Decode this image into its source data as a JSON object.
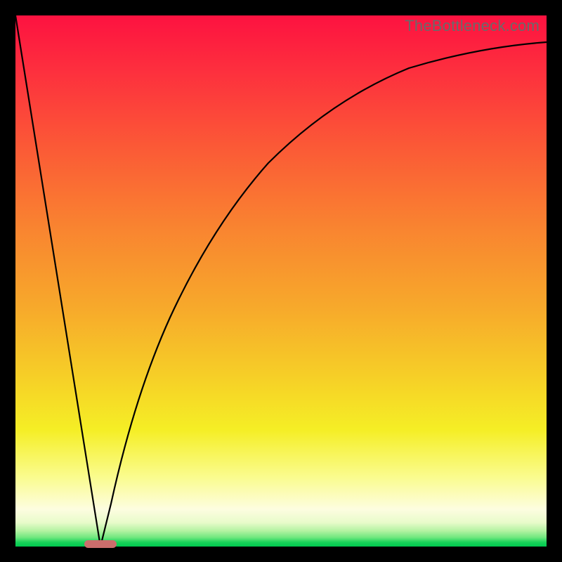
{
  "watermark": "TheBottleneck.com",
  "colors": {
    "frame": "#000000",
    "curve": "#000000",
    "pill": "#cc6d6c"
  },
  "chart_data": {
    "type": "line",
    "title": "",
    "xlabel": "",
    "ylabel": "",
    "xlim": [
      0,
      100
    ],
    "ylim": [
      0,
      100
    ],
    "grid": false,
    "legend": false,
    "comment": "Bottleneck-style V curve. Values are read off the plot as % of axis range (no ticks shown). x is horizontal position 0..100, y is vertical height 0..100 (0=bottom).",
    "series": [
      {
        "name": "left-branch",
        "x": [
          0,
          4,
          8,
          12,
          14,
          16
        ],
        "y": [
          100,
          75,
          50,
          25,
          12.5,
          0
        ]
      },
      {
        "name": "right-branch",
        "x": [
          16,
          18,
          20,
          24,
          28,
          32,
          36,
          40,
          45,
          50,
          56,
          62,
          70,
          78,
          86,
          94,
          100
        ],
        "y": [
          0,
          8,
          16,
          30,
          42,
          52,
          60,
          66,
          72,
          77,
          81,
          84.5,
          88,
          90.5,
          92.5,
          94,
          95
        ]
      }
    ],
    "marker": {
      "name": "optimal-pill",
      "x_center": 16,
      "width": 6,
      "y": 0
    }
  }
}
